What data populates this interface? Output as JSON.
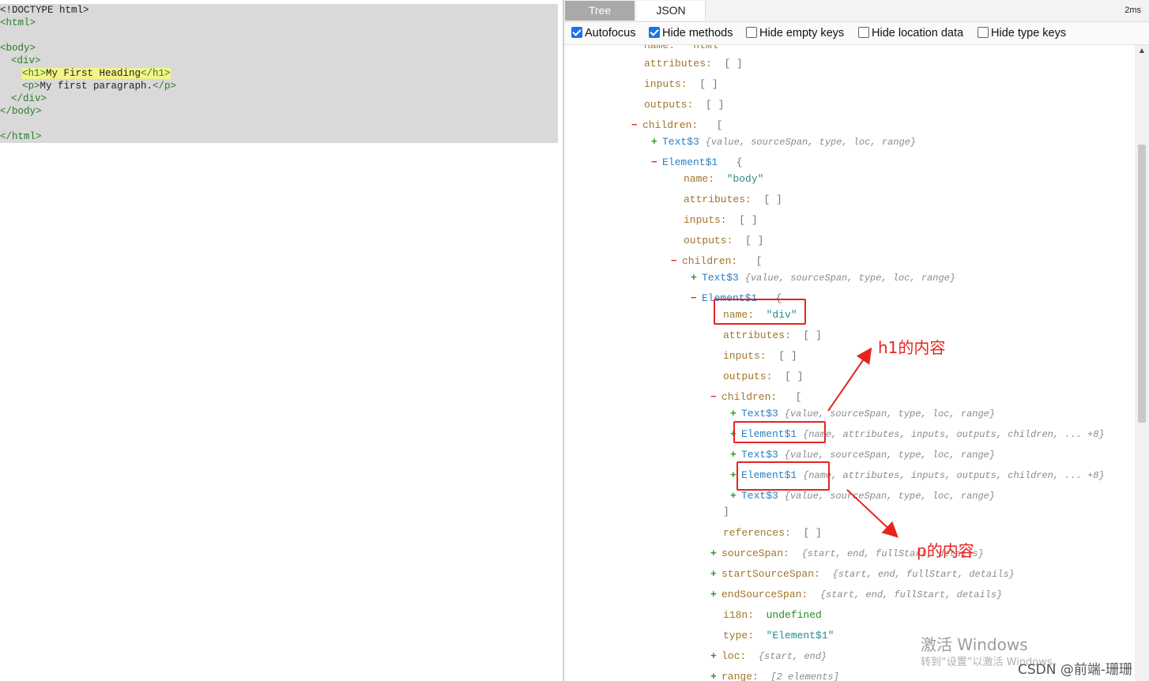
{
  "code": {
    "doctype": "<!DOCTYPE html>",
    "html_open": "<html>",
    "body_open": "<body>",
    "div_open": "<div>",
    "h1_open": "<h1>",
    "h1_text": "My First Heading",
    "h1_close": "</h1>",
    "p_open": "<p>",
    "p_text": "My first paragraph.",
    "p_close": "</p>",
    "div_close": "</div>",
    "body_close": "</body>",
    "html_close": "</html>"
  },
  "tabs": {
    "tree": "Tree",
    "json": "JSON"
  },
  "time": "2ms",
  "options": [
    {
      "label": "Autofocus",
      "checked": true
    },
    {
      "label": "Hide methods",
      "checked": true
    },
    {
      "label": "Hide empty keys",
      "checked": false
    },
    {
      "label": "Hide location data",
      "checked": false
    },
    {
      "label": "Hide type keys",
      "checked": false
    }
  ],
  "tree": {
    "cut_top": "name:  \"html\"",
    "attributes": "attributes:",
    "inputs": "inputs:",
    "outputs": "outputs:",
    "children": "children:",
    "references": "references:",
    "empty_array": "[ ]",
    "open_bracket": "[",
    "close_bracket": "]",
    "open_brace": "{",
    "text3": "Text$3",
    "element1": "Element$1",
    "text3_summary": "{value, sourceSpan, type, loc, range}",
    "element1_summary": "{name, attributes, inputs, outputs, children, ... +8}",
    "name_key": "name:",
    "body_value": "\"body\"",
    "div_value": "\"div\"",
    "sourceSpan": "sourceSpan:",
    "sourceSpan_summary": "{start, end, fullStart, details}",
    "startSourceSpan": "startSourceSpan:",
    "startSourceSpan_summary": "{start, end, fullStart, details}",
    "endSourceSpan": "endSourceSpan:",
    "endSourceSpan_summary": "{start, end, fullStart, details}",
    "i18n": "i18n:",
    "i18n_value": "undefined",
    "type_key": "type:",
    "type_value": "\"Element$1\"",
    "loc": "loc:",
    "loc_summary": "{start, end}",
    "range": "range:",
    "range_summary": "[2 elements]"
  },
  "annotations": {
    "h1": "h1的内容",
    "p": "p的内容"
  },
  "watermark": {
    "line1": "激活 Windows",
    "line2": "转到“设置”以激活 Windows。"
  },
  "csdn": "CSDN @前端-珊珊",
  "colors": {
    "annotation": "#e8231f",
    "tab_active": "#a9a9a9",
    "checkbox": "#1a73e8"
  }
}
